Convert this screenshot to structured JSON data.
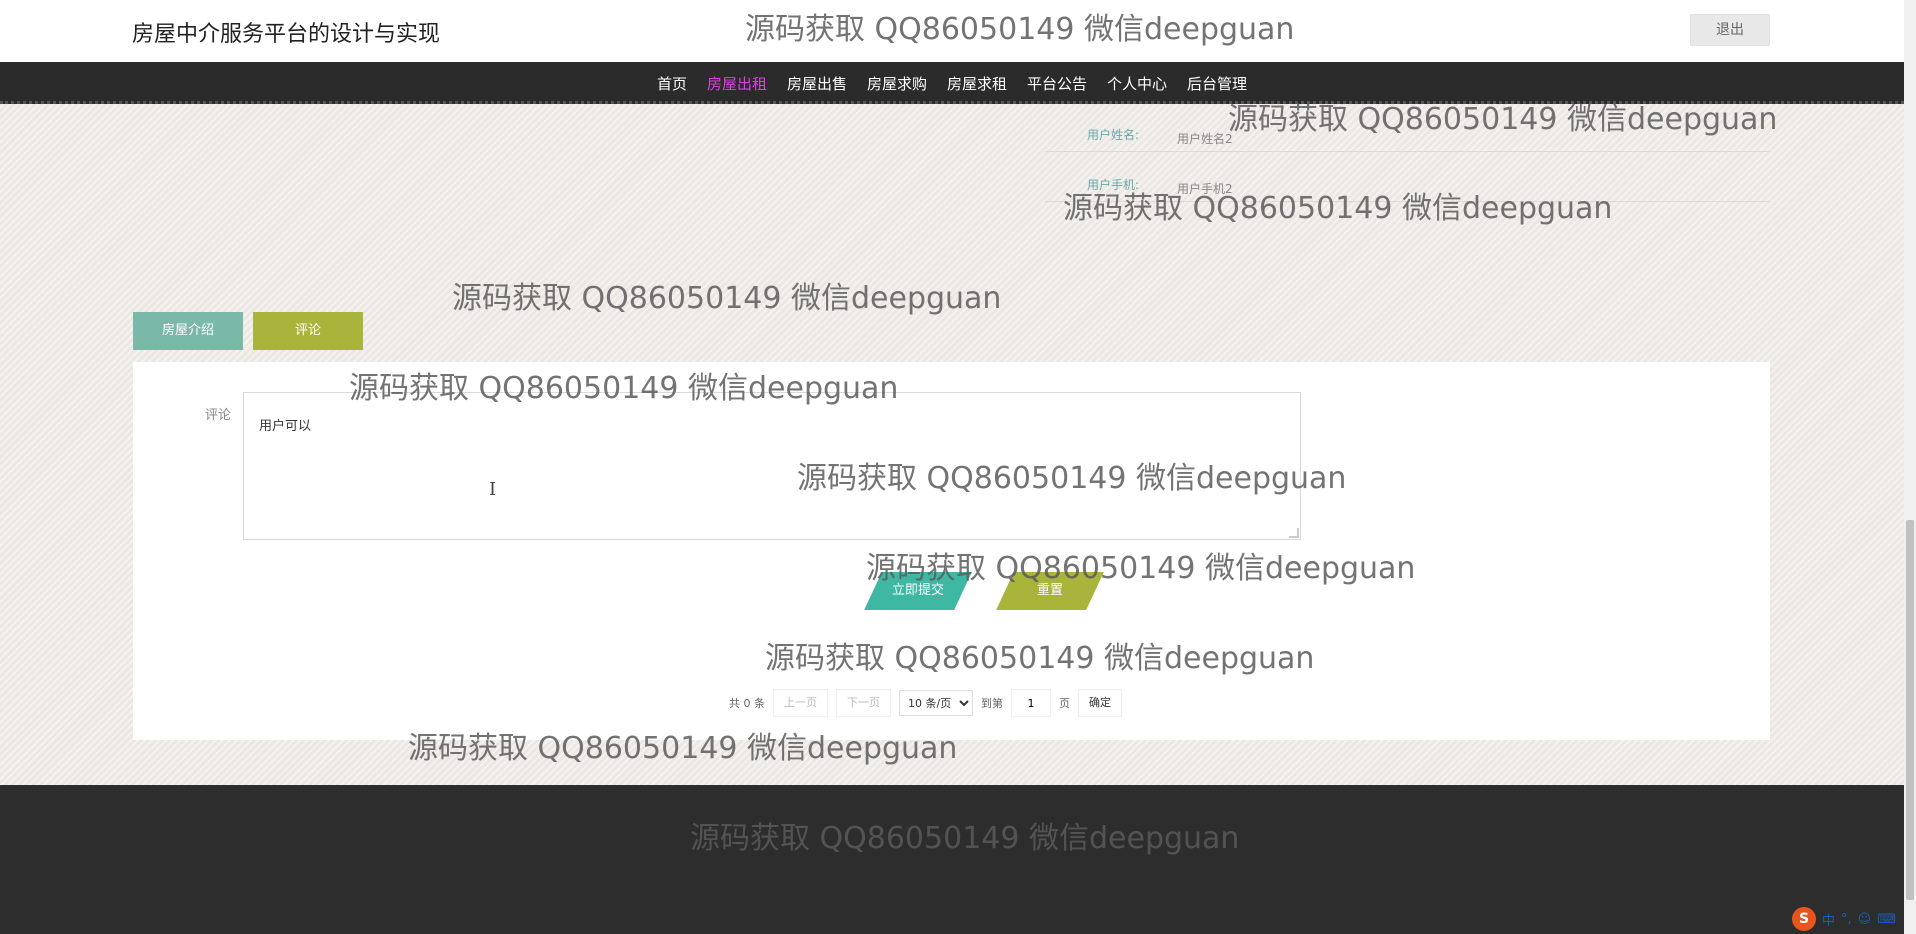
{
  "header": {
    "title": "房屋中介服务平台的设计与实现",
    "logout_label": "退出"
  },
  "nav": {
    "items": [
      "首页",
      "房屋出租",
      "房屋出售",
      "房屋求购",
      "房屋求租",
      "平台公告",
      "个人中心",
      "后台管理"
    ],
    "active_index": 1,
    "active_color": "#e13ee3"
  },
  "user_info": [
    {
      "label": "用户姓名:",
      "value": "用户姓名2"
    },
    {
      "label": "用户手机:",
      "value": "用户手机2"
    }
  ],
  "tabs": {
    "intro_label": "房屋介绍",
    "comment_label": "评论"
  },
  "comment_form": {
    "label": "评论",
    "value": "用户可以",
    "submit_label": "立即提交",
    "reset_label": "重置"
  },
  "pagination": {
    "total_text": "共 0 条",
    "prev_label": "上一页",
    "next_label": "下一页",
    "page_size_option": "10 条/页",
    "goto_label": "到第",
    "page_value": "1",
    "page_unit": "页",
    "confirm_label": "确定"
  },
  "watermark_text": "源码获取 QQ86050149 微信deepguan",
  "ime": {
    "logo": "S",
    "mode": "中"
  },
  "colors": {
    "tab_intro": "#7ab9a7",
    "tab_comment": "#a9b43a",
    "submit": "#3fb8a3",
    "reset": "#a9b43a"
  }
}
